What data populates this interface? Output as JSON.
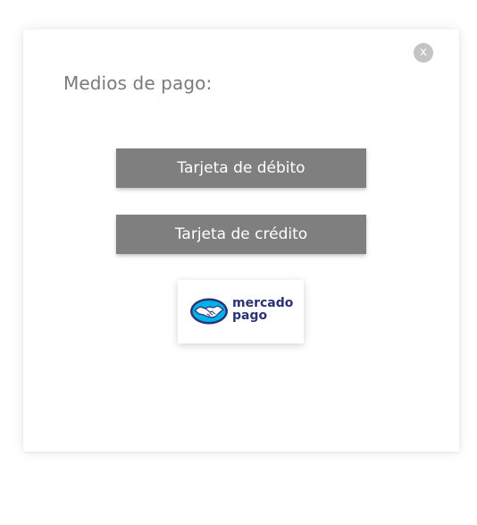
{
  "modal": {
    "close_label": "x",
    "title": "Medios de pago:",
    "options": {
      "debit_label": "Tarjeta de débito",
      "credit_label": "Tarjeta de crédito"
    },
    "mercadopago": {
      "line1": "mercado",
      "line2": "pago",
      "icon": "handshake-icon"
    }
  },
  "colors": {
    "button_bg": "#7f7f7f",
    "button_text": "#ffffff",
    "title_text": "#7a7a7a",
    "close_bg": "#c4c4c4",
    "mp_blue": "#2d3277",
    "mp_light_blue": "#00b1ea"
  }
}
